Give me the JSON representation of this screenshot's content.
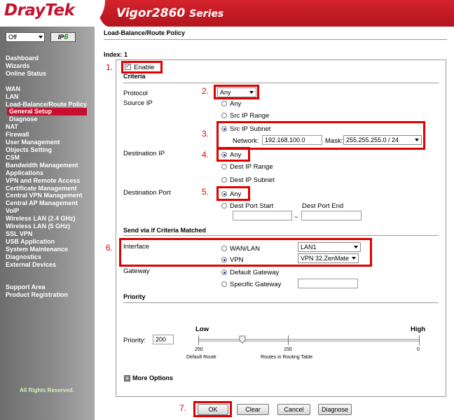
{
  "header": {
    "brand": "DrayTek",
    "model": "Vigor2860",
    "series": "Series"
  },
  "sidebar": {
    "mode_select": "Off",
    "ipv6_label": "IP",
    "ipv6_num": "6",
    "items": [
      {
        "label": "Dashboard"
      },
      {
        "label": "Wizards"
      },
      {
        "label": "Online Status"
      },
      {
        "label": ""
      },
      {
        "label": "WAN"
      },
      {
        "label": "LAN"
      },
      {
        "label": "Load-Balance/Route Policy"
      },
      {
        "label": "General Setup",
        "active": true
      },
      {
        "label": "Diagnose",
        "sub": true
      },
      {
        "label": "NAT"
      },
      {
        "label": "Firewall"
      },
      {
        "label": "User Management"
      },
      {
        "label": "Objects Setting"
      },
      {
        "label": "CSM"
      },
      {
        "label": "Bandwidth Management"
      },
      {
        "label": "Applications"
      },
      {
        "label": "VPN and Remote Access"
      },
      {
        "label": "Certificate Management"
      },
      {
        "label": "Central VPN Management"
      },
      {
        "label": "Central AP Management"
      },
      {
        "label": "VoIP"
      },
      {
        "label": "Wireless LAN (2.4 GHz)"
      },
      {
        "label": "Wireless LAN (5 GHz)"
      },
      {
        "label": "SSL VPN"
      },
      {
        "label": "USB Application"
      },
      {
        "label": "System Maintenance"
      },
      {
        "label": "Diagnostics"
      },
      {
        "label": "External Devices"
      },
      {
        "label": ""
      },
      {
        "label": ""
      },
      {
        "label": "Support Area"
      },
      {
        "label": "Product Registration"
      }
    ],
    "rights": "All Rights Reserved."
  },
  "main": {
    "page_title": "Load-Balance/Route Policy",
    "index_label": "Index: 1",
    "enable_label": "Enable",
    "criteria_header": "Criteria",
    "protocol_label": "Protocol",
    "protocol_value": "Any",
    "source_ip_label": "Source IP",
    "src_any": "Any",
    "src_range": "Src IP Range",
    "src_subnet": "Src IP Subnet",
    "network_label": "Network:",
    "network_value": "192.168.100.0",
    "mask_label": "Mask:",
    "mask_value": "255.255.255.0 / 24",
    "dest_ip_label": "Destination IP",
    "dest_any": "Any",
    "dest_range": "Dest IP Range",
    "dest_subnet": "Dest IP Subnet",
    "dest_port_label": "Destination Port",
    "port_any": "Any",
    "port_start": "Dest Port Start",
    "port_end": "Dest Port End",
    "port_sep": "~",
    "send_header": "Send via if Criteria Matched",
    "interface_label": "Interface",
    "wan_lan": "WAN/LAN",
    "wan_lan_value": "LAN1",
    "vpn": "VPN",
    "vpn_value": "VPN 32.ZenMate",
    "gateway_label": "Gateway",
    "default_gw": "Default Gateway",
    "specific_gw": "Specific Gateway",
    "priority_header": "Priority",
    "priority_label": "Priority:",
    "priority_value": "200",
    "low": "Low",
    "high": "High",
    "tick_250": "250",
    "tick_150": "150",
    "tick_0": "0",
    "default_route": "Default Route",
    "routes_table": "Routes in Routing Table",
    "more_options": "More Options",
    "plus": "+"
  },
  "buttons": {
    "ok": "OK",
    "clear": "Clear",
    "cancel": "Cancel",
    "diagnose": "Diagnose"
  },
  "annotations": [
    "1.",
    "2.",
    "3.",
    "4.",
    "5.",
    "6.",
    "7."
  ],
  "colors": {
    "brand_red": "#c8102e",
    "annotation_red": "#e00000",
    "sidebar_gray": "#8a8a8a"
  }
}
